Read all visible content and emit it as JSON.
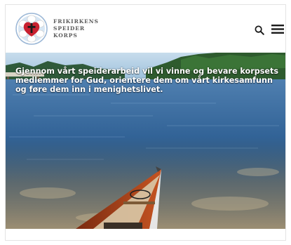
{
  "header": {
    "logo_lines": [
      "FRIKIRKENS",
      "SPEIDER",
      "KORPS"
    ],
    "search_icon": "search-icon",
    "menu_icon": "hamburger-menu-icon"
  },
  "hero": {
    "text": "Gjennom vårt speiderarbeid vil vi vinne og bevare korpsets medlemmer for Gud, orientere dem om vårt kirkesamfunn og føre dem inn i menighetslivet.",
    "image": "lake-with-canoe-photo"
  },
  "colors": {
    "logo_red": "#c8202f",
    "logo_blue": "#2f6fb2",
    "logo_text": "#5a5a5a",
    "water": "#2a5d8f",
    "canoe": "#b5451b"
  }
}
